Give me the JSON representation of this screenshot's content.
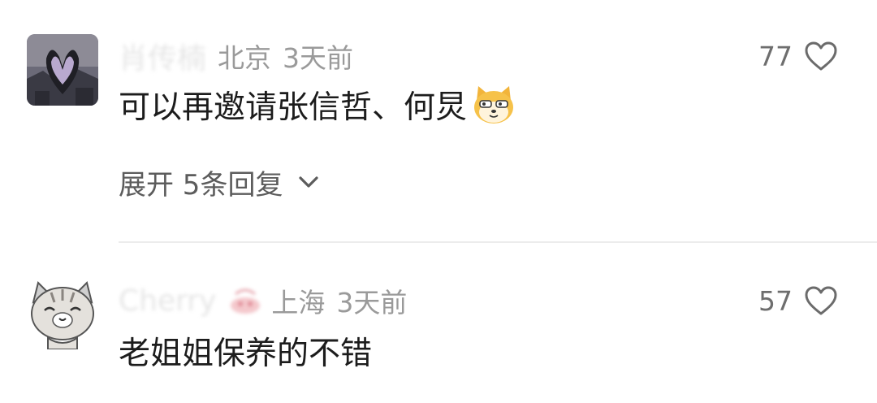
{
  "comments": [
    {
      "username": "肖传楠",
      "location": "北京",
      "time": "3天前",
      "likes": "77",
      "content": "可以再邀请张信哲、何炅",
      "emoji": "doge-cat-emoji",
      "replies_label": "展开 5条回复"
    },
    {
      "username": "Cherry",
      "location": "上海",
      "time": "3天前",
      "likes": "57",
      "content": "老姐姐保养的不错"
    }
  ],
  "colors": {
    "meta_gray": "#9a9a9a",
    "like_gray": "#6e6e6e",
    "divider": "#ececec"
  }
}
